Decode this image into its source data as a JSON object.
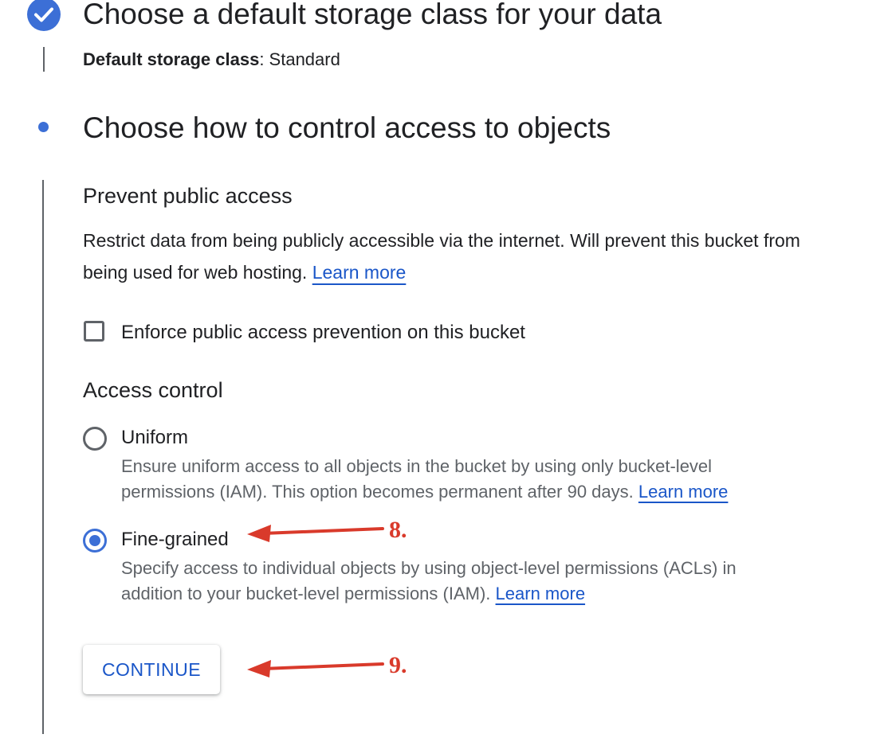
{
  "step1": {
    "title": "Choose a default storage class for your data",
    "summary_key": "Default storage class",
    "summary_sep": ": ",
    "summary_value": "Standard"
  },
  "step2": {
    "title": "Choose how to control access to objects",
    "prevent_public": {
      "heading": "Prevent public access",
      "description": "Restrict data from being publicly accessible via the internet. Will prevent this bucket from being used for web hosting.",
      "learn_more": "Learn more",
      "checkbox_label": "Enforce public access prevention on this bucket",
      "checkbox_checked": false
    },
    "access_control": {
      "heading": "Access control",
      "options": [
        {
          "label": "Uniform",
          "desc_line1": "Ensure uniform access to all objects in the bucket by using only bucket-level",
          "desc_line2": "permissions (IAM). This option becomes permanent after 90 days.",
          "learn_more": "Learn more",
          "selected": false
        },
        {
          "label": "Fine-grained",
          "desc_line1": "Specify access to individual objects by using object-level permissions (ACLs) in",
          "desc_line2": "addition to your bucket-level permissions (IAM).",
          "learn_more": "Learn more",
          "selected": true
        }
      ]
    },
    "continue_label": "CONTINUE"
  },
  "annotations": [
    {
      "label": "8."
    },
    {
      "label": "9."
    }
  ],
  "colors": {
    "accent": "#3c6fd6",
    "link": "#1a56c8",
    "annotation": "#d93a2b"
  }
}
